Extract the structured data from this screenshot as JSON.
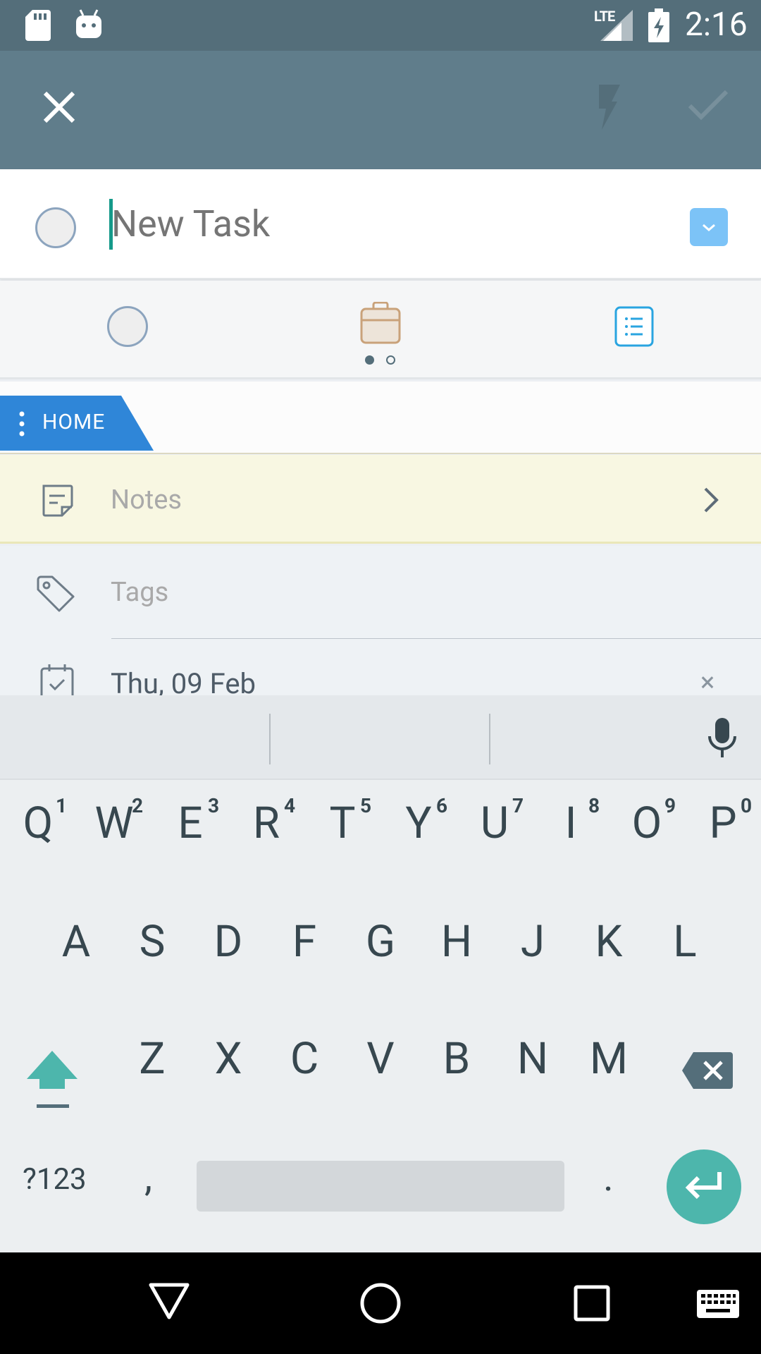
{
  "status_bar": {
    "time": "2:16",
    "network": "LTE",
    "icons": [
      "sd-card-icon",
      "android-icon",
      "signal-icon",
      "battery-charging-icon"
    ]
  },
  "toolbar": {
    "close_icon": "close-icon",
    "quick_icon": "lightning-icon",
    "save_icon": "check-icon"
  },
  "task": {
    "placeholder": "New Task",
    "value": ""
  },
  "type_switcher": {
    "options": [
      "task-circle",
      "project-briefcase",
      "checklist"
    ],
    "page_indicator": {
      "pages": 2,
      "active": 1
    }
  },
  "category": {
    "label": "HOME",
    "color": "#2F86D8"
  },
  "fields": {
    "notes_label": "Notes",
    "tags_label": "Tags",
    "date_label": "Thu, 09 Feb",
    "date_clear": "×"
  },
  "keyboard": {
    "row1": [
      "Q",
      "W",
      "E",
      "R",
      "T",
      "Y",
      "U",
      "I",
      "O",
      "P"
    ],
    "row1_hints": [
      "1",
      "2",
      "3",
      "4",
      "5",
      "6",
      "7",
      "8",
      "9",
      "0"
    ],
    "row2": [
      "A",
      "S",
      "D",
      "F",
      "G",
      "H",
      "J",
      "K",
      "L"
    ],
    "row3": [
      "Z",
      "X",
      "C",
      "V",
      "B",
      "N",
      "M"
    ],
    "symbols_label": "?123",
    "comma": ",",
    "period": ".",
    "accent_color": "#4DB6AC"
  },
  "colors": {
    "status_bar": "#546E7A",
    "toolbar": "#607D8B",
    "notes_bg": "#F8F7E2"
  }
}
